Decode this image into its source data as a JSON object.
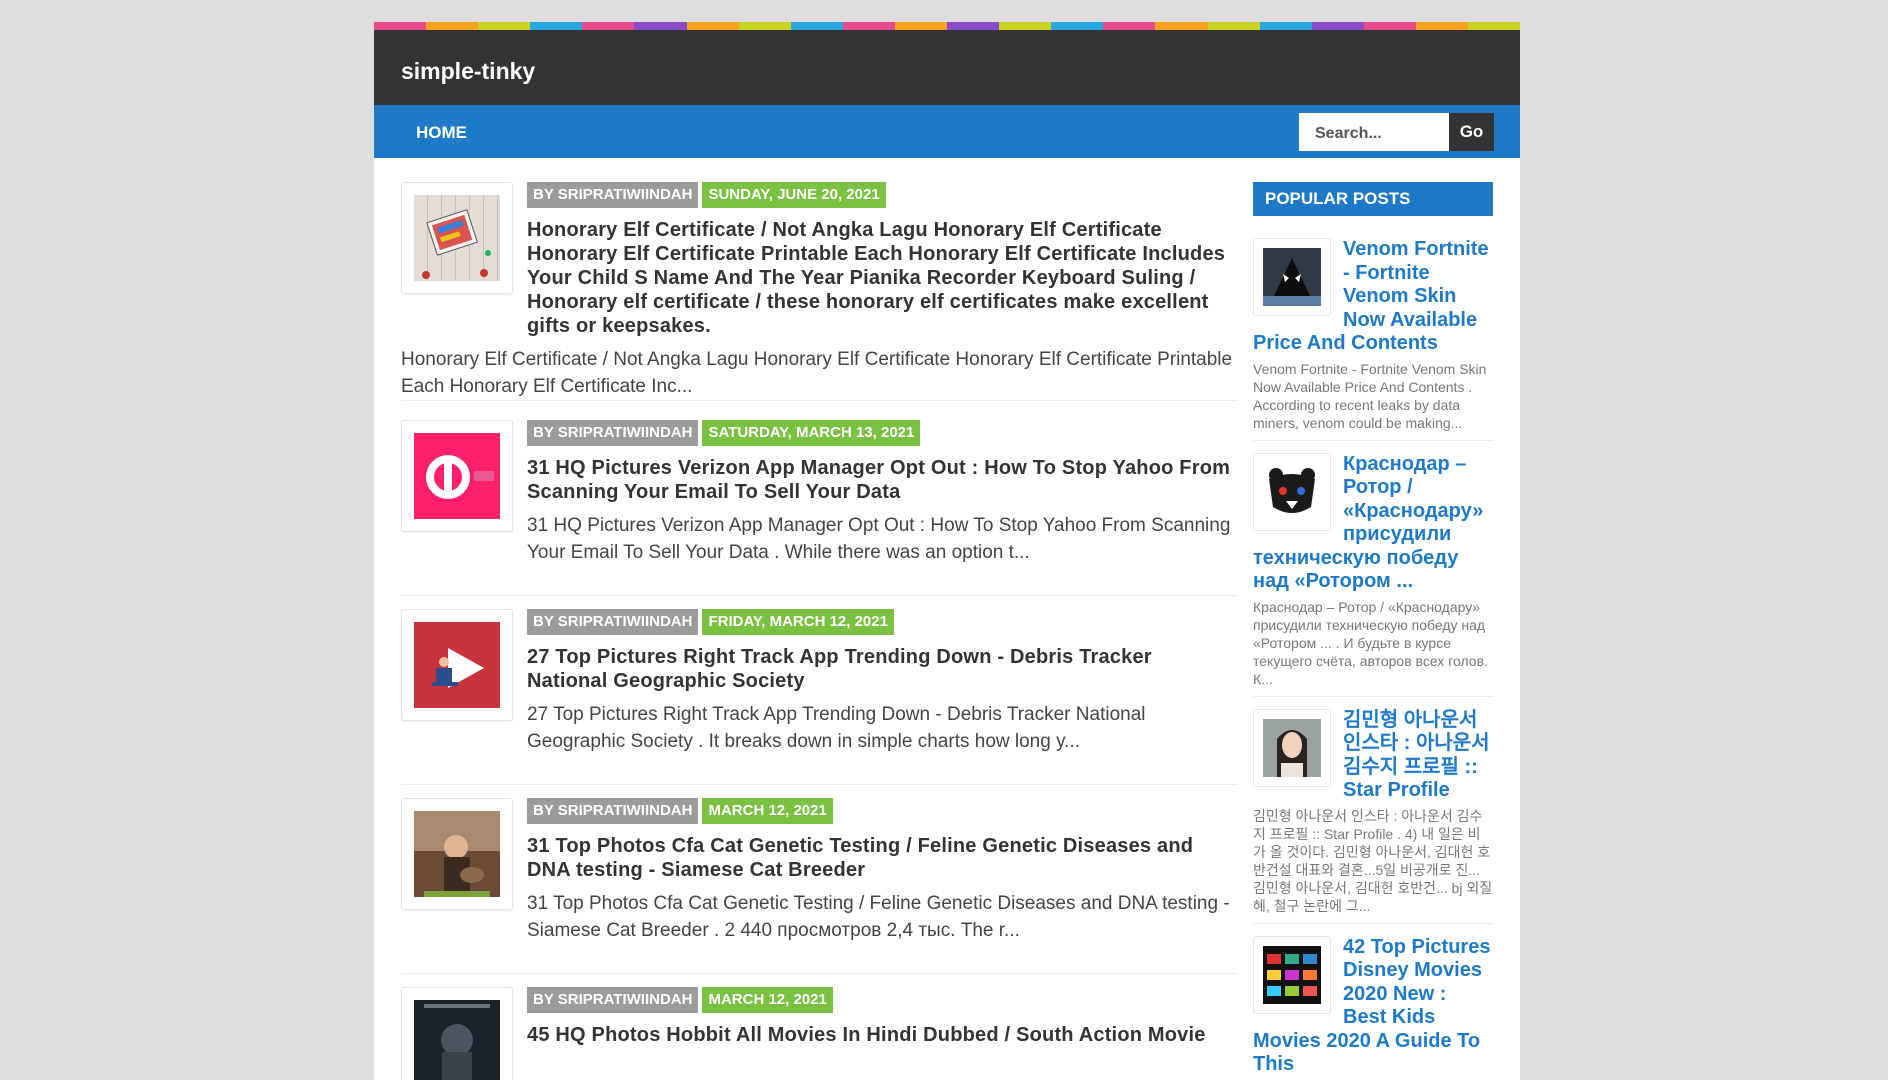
{
  "site": {
    "title": "simple-tinky"
  },
  "stripe_colors": [
    "#e84a8e",
    "#f7a21b",
    "#c9d422",
    "#29a8e0",
    "#e84a8e",
    "#8b4ac8",
    "#f7a21b",
    "#c9d422",
    "#29a8e0",
    "#e84a8e",
    "#f7a21b",
    "#8b4ac8",
    "#c9d422",
    "#29a8e0",
    "#e84a8e",
    "#f7a21b",
    "#c9d422",
    "#29a8e0",
    "#8b4ac8",
    "#e84a8e",
    "#f7a21b",
    "#c9d422"
  ],
  "nav": {
    "home_label": "HOME",
    "search_placeholder": "Search...",
    "go_label": "Go"
  },
  "colors": {
    "accent": "#1e7ac8",
    "header": "#333333",
    "date_badge": "#7ac142",
    "author_badge": "#9b9b9b"
  },
  "posts": [
    {
      "author": "BY SRIPRATIWIINDAH",
      "date": "SUNDAY, JUNE 20, 2021",
      "title": "Honorary Elf Certificate / Not Angka Lagu Honorary Elf Certificate Honorary Elf Certificate Printable Each Honorary Elf Certificate Includes Your Child S Name And The Year Pianika Recorder Keyboard Suling / Honorary elf certificate / these honorary elf certificates make excellent gifts or keepsakes.",
      "snippet": "Honorary Elf Certificate / Not Angka Lagu Honorary Elf Certificate Honorary Elf Certificate Printable Each Honorary Elf Certificate Inc...",
      "thumb_icon": "elf-certificate-image"
    },
    {
      "author": "BY SRIPRATIWIINDAH",
      "date": "SATURDAY, MARCH 13, 2021",
      "title": "31 HQ Pictures Verizon App Manager Opt Out : How To Stop Yahoo From Scanning Your Email To Sell Your Data",
      "snippet": "31 HQ Pictures Verizon App Manager Opt Out : How To Stop Yahoo From Scanning Your Email To Sell Your Data . While there was an option t...",
      "thumb_icon": "verizon-app-image"
    },
    {
      "author": "BY SRIPRATIWIINDAH",
      "date": "FRIDAY, MARCH 12, 2021",
      "title": "27 Top Pictures Right Track App Trending Down - Debris Tracker National Geographic Society",
      "snippet": "27 Top Pictures Right Track App Trending Down - Debris Tracker National Geographic Society . It breaks down in simple charts how long y...",
      "thumb_icon": "play-button-image"
    },
    {
      "author": "BY SRIPRATIWIINDAH",
      "date": "MARCH 12, 2021",
      "title": "31 Top Photos Cfa Cat Genetic Testing / Feline Genetic Diseases and DNA testing - Siamese Cat Breeder",
      "snippet": "31 Top Photos Cfa Cat Genetic Testing / Feline Genetic Diseases and DNA testing - Siamese Cat Breeder . 2 440 просмотров 2,4 тыс. The r...",
      "thumb_icon": "cat-photo-image"
    },
    {
      "author": "BY SRIPRATIWIINDAH",
      "date": "MARCH 12, 2021",
      "title": "45 HQ Photos Hobbit All Movies In Hindi Dubbed / South Action Movie",
      "snippet": "",
      "thumb_icon": "hobbit-poster-image"
    }
  ],
  "sidebar": {
    "heading": "POPULAR POSTS",
    "items": [
      {
        "title": "Venom Fortnite - Fortnite Venom Skin Now Available Price And Contents",
        "snippet": "Venom Fortnite - Fortnite Venom Skin Now Available Price And Contents . According to recent leaks by data miners, venom could be making...",
        "thumb_icon": "venom-image"
      },
      {
        "title": "Краснодар – Ротор / «Краснодару» присудили техническую победу над «Ротором ...",
        "snippet": "Краснодар – Ротор / «Краснодару» присудили техническую победу над «Ротором ... . И будьте в курсе текущего счёта, авторов всех голов. К...",
        "thumb_icon": "bear-logo-image"
      },
      {
        "title": "김민형 아나운서 인스타 : 아나운서 김수지 프로필 :: Star Profile",
        "snippet": "김민형 아나운서 인스타 : 아나운서 김수지 프로필 :: Star Profile . 4) 내 일은 비가 올 것이다. 김민형 아나운서, 김대헌 호반건설 대표와 결혼...5일 비공개로 진... 김민형 아나운서, 김대헌 호반건... bj 외질혜, 철구 논란에 그...",
        "thumb_icon": "portrait-image"
      },
      {
        "title": "42 Top Pictures Disney Movies 2020 New : Best Kids Movies 2020 A Guide To This",
        "snippet": "",
        "thumb_icon": "disney-movies-image"
      }
    ]
  }
}
